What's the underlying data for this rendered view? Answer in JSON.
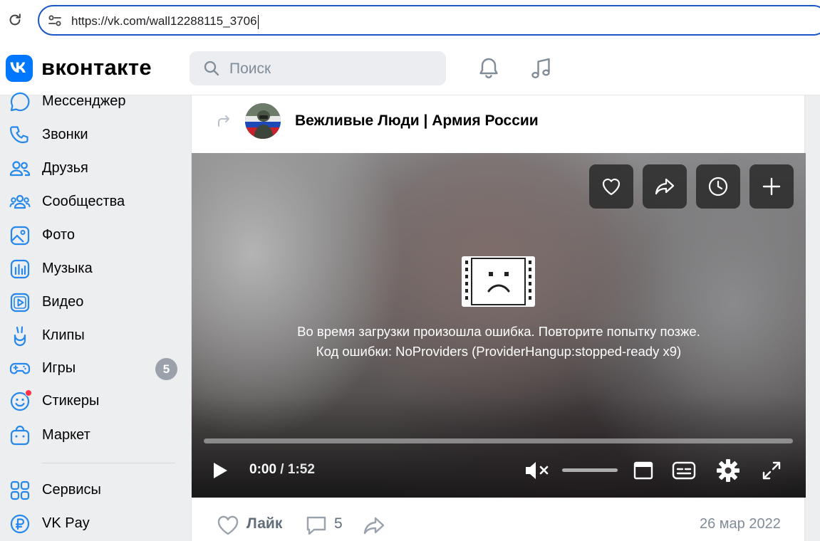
{
  "browser": {
    "url": "https://vk.com/wall12288115_3706"
  },
  "header": {
    "wordmark": "вконтакте",
    "search_placeholder": "Поиск"
  },
  "sidebar": {
    "items": [
      {
        "label": "Мессенджер",
        "icon": "messenger-icon"
      },
      {
        "label": "Звонки",
        "icon": "phone-icon"
      },
      {
        "label": "Друзья",
        "icon": "friends-icon"
      },
      {
        "label": "Сообщества",
        "icon": "communities-icon"
      },
      {
        "label": "Фото",
        "icon": "photo-icon"
      },
      {
        "label": "Музыка",
        "icon": "music-icon"
      },
      {
        "label": "Видео",
        "icon": "video-icon"
      },
      {
        "label": "Клипы",
        "icon": "clips-icon"
      },
      {
        "label": "Игры",
        "icon": "games-icon",
        "badge": "5"
      },
      {
        "label": "Стикеры",
        "icon": "stickers-icon",
        "has_dot": true
      },
      {
        "label": "Маркет",
        "icon": "market-icon"
      },
      {
        "label": "Сервисы",
        "icon": "services-icon"
      },
      {
        "label": "VK Pay",
        "icon": "vkpay-icon"
      }
    ]
  },
  "post": {
    "author": "Вежливые Люди | Армия России",
    "video": {
      "error_line1": "Во время загрузки произошла ошибка. Повторите попытку позже.",
      "error_line2": "Код ошибки: NoProviders (ProviderHangup:stopped-ready x9)",
      "time_current": "0:00",
      "time_separator": " / ",
      "time_total": "1:52",
      "progress_fraction": 0,
      "top_buttons": [
        "heart-icon",
        "share-icon",
        "watch-later-icon",
        "add-icon"
      ]
    },
    "footer": {
      "like_label": "Лайк",
      "comments_count": "5",
      "date": "26 мар 2022"
    }
  },
  "colors": {
    "vk_blue": "#0077ff",
    "sidebar_icon": "#2688eb",
    "url_border": "#1a56c9",
    "badge_gray": "#9ba1ab",
    "notification_dot": "#ff3347"
  }
}
